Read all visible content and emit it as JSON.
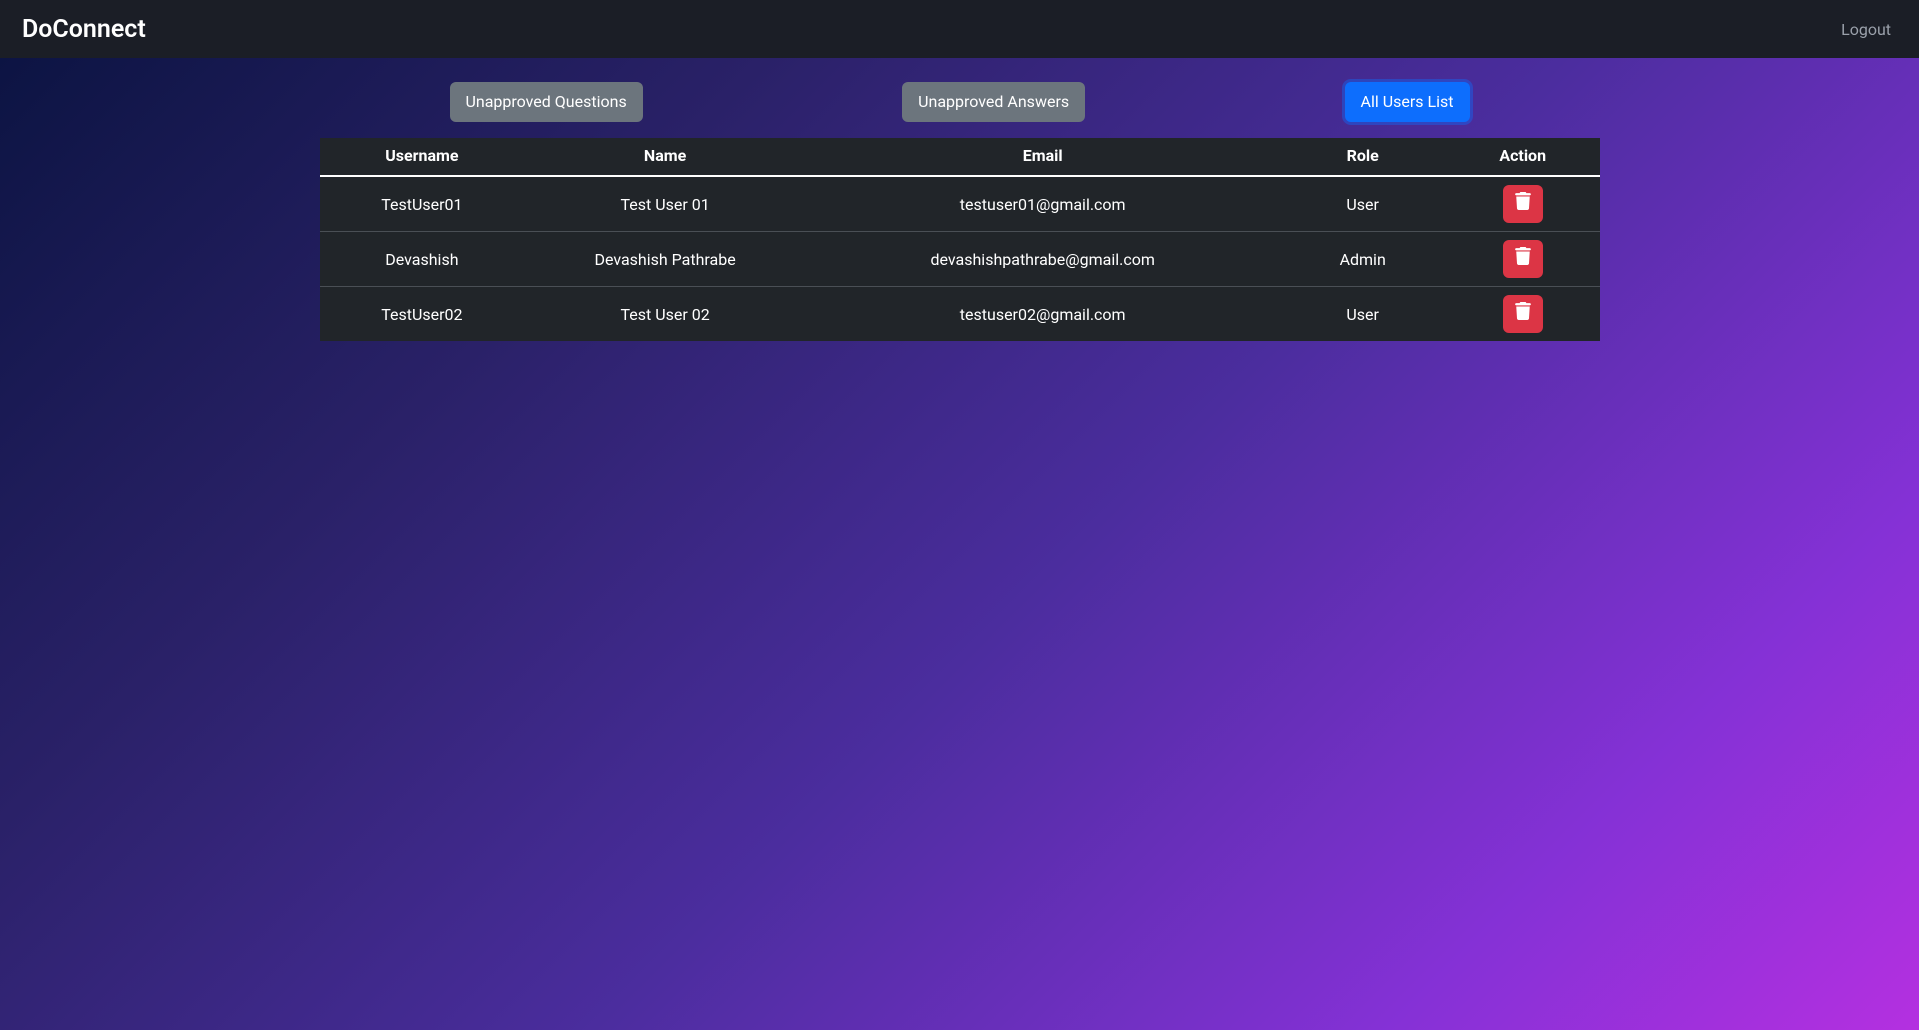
{
  "navbar": {
    "brand": "DoConnect",
    "logout": "Logout"
  },
  "tabs": {
    "unapproved_questions": "Unapproved Questions",
    "unapproved_answers": "Unapproved Answers",
    "all_users": "All Users List"
  },
  "table": {
    "headers": {
      "username": "Username",
      "name": "Name",
      "email": "Email",
      "role": "Role",
      "action": "Action"
    },
    "rows": [
      {
        "username": "TestUser01",
        "name": "Test User 01",
        "email": "testuser01@gmail.com",
        "role": "User"
      },
      {
        "username": "Devashish",
        "name": "Devashish Pathrabe",
        "email": "devashishpathrabe@gmail.com",
        "role": "Admin"
      },
      {
        "username": "TestUser02",
        "name": "Test User 02",
        "email": "testuser02@gmail.com",
        "role": "User"
      }
    ]
  }
}
